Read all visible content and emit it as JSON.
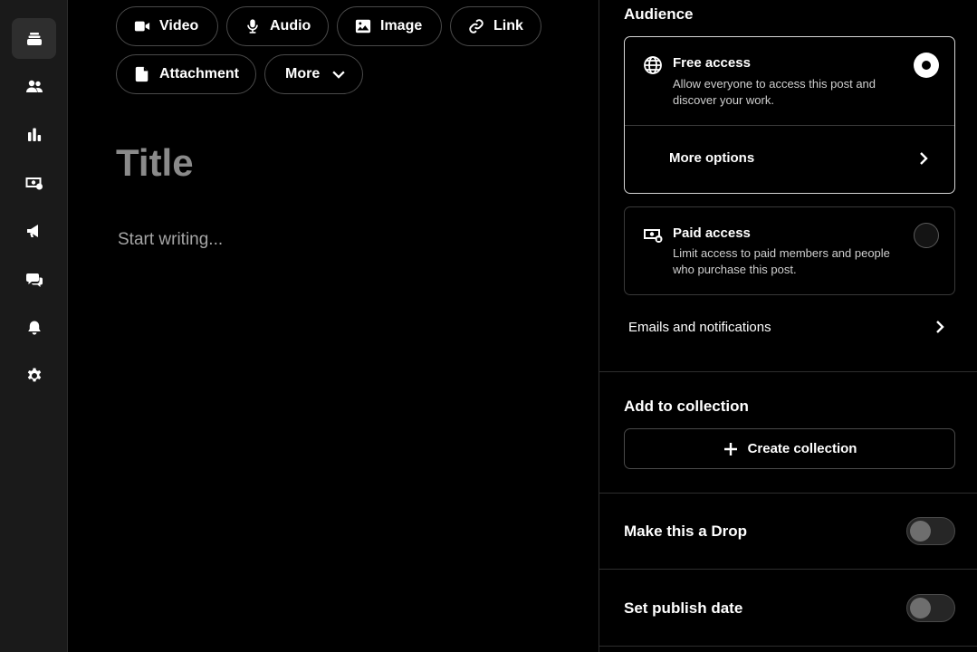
{
  "sidebar": {
    "items": [
      {
        "icon": "stack-icon",
        "active": true
      },
      {
        "icon": "members-icon"
      },
      {
        "icon": "analytics-icon"
      },
      {
        "icon": "money-icon"
      },
      {
        "icon": "megaphone-icon"
      },
      {
        "icon": "chat-icon"
      },
      {
        "icon": "bell-icon"
      },
      {
        "icon": "gear-icon"
      }
    ]
  },
  "toolbar": {
    "video_label": "Video",
    "audio_label": "Audio",
    "image_label": "Image",
    "link_label": "Link",
    "attachment_label": "Attachment",
    "more_label": "More"
  },
  "editor": {
    "title_placeholder": "Title",
    "body_placeholder": "Start writing..."
  },
  "panel": {
    "audience_heading": "Audience",
    "free_access": {
      "title": "Free access",
      "description": "Allow everyone to access this post and discover your work.",
      "selected": true
    },
    "more_options_label": "More options",
    "paid_access": {
      "title": "Paid access",
      "description": "Limit access to paid members and people who purchase this post.",
      "selected": false
    },
    "emails_label": "Emails and notifications",
    "collection_heading": "Add to collection",
    "create_collection_label": "Create collection",
    "drop_label": "Make this a Drop",
    "drop_enabled": false,
    "publish_date_label": "Set publish date",
    "publish_date_enabled": false
  },
  "colors": {
    "background": "#000000",
    "sidebar": "#1a1a1a",
    "placeholder": "#8a8a8a"
  }
}
